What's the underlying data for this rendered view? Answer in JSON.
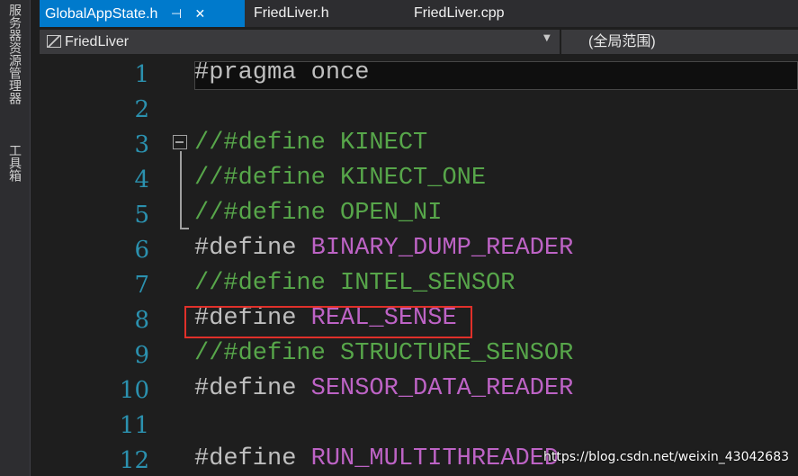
{
  "sidebar": {
    "tabs": [
      {
        "label": "服务器资源管理器"
      },
      {
        "label": "工具箱"
      }
    ]
  },
  "tabs": [
    {
      "label": "GlobalAppState.h",
      "pin": "⊣",
      "close": "✕",
      "active": true
    },
    {
      "label": "FriedLiver.h",
      "active": false
    },
    {
      "label": "FriedLiver.cpp",
      "active": false
    }
  ],
  "navbar": {
    "project": "FriedLiver",
    "scope": "(全局范围)"
  },
  "editor": {
    "lines": [
      {
        "num": "1",
        "parts": [
          {
            "t": "#pragma once",
            "c": "kw"
          }
        ]
      },
      {
        "num": "2",
        "parts": []
      },
      {
        "num": "3",
        "parts": [
          {
            "t": "//#define KINECT",
            "c": "cmt"
          }
        ]
      },
      {
        "num": "4",
        "parts": [
          {
            "t": "//#define KINECT_ONE",
            "c": "cmt"
          }
        ]
      },
      {
        "num": "5",
        "parts": [
          {
            "t": "//#define OPEN_NI",
            "c": "cmt"
          }
        ]
      },
      {
        "num": "6",
        "parts": [
          {
            "t": "#define ",
            "c": "kw"
          },
          {
            "t": "BINARY_DUMP_READER",
            "c": "mac"
          }
        ]
      },
      {
        "num": "7",
        "parts": [
          {
            "t": "//#define INTEL_SENSOR",
            "c": "cmt"
          }
        ]
      },
      {
        "num": "8",
        "parts": [
          {
            "t": "#define ",
            "c": "kw"
          },
          {
            "t": "REAL_SENSE",
            "c": "mac"
          }
        ]
      },
      {
        "num": "9",
        "parts": [
          {
            "t": "//#define STRUCTURE_SENSOR",
            "c": "cmt"
          }
        ]
      },
      {
        "num": "10",
        "parts": [
          {
            "t": "#define ",
            "c": "kw"
          },
          {
            "t": "SENSOR_DATA_READER",
            "c": "mac"
          }
        ]
      },
      {
        "num": "11",
        "parts": []
      },
      {
        "num": "12",
        "parts": [
          {
            "t": "#define ",
            "c": "kw"
          },
          {
            "t": "RUN_MULTITHREADED",
            "c": "mac"
          }
        ]
      }
    ]
  },
  "watermark": "https://blog.csdn.net/weixin_43042683",
  "colors": {
    "accent": "#007acc",
    "comment": "#57a64a",
    "macro": "#bd63c5",
    "linenum": "#2b91af",
    "highlight": "#e0302a"
  }
}
